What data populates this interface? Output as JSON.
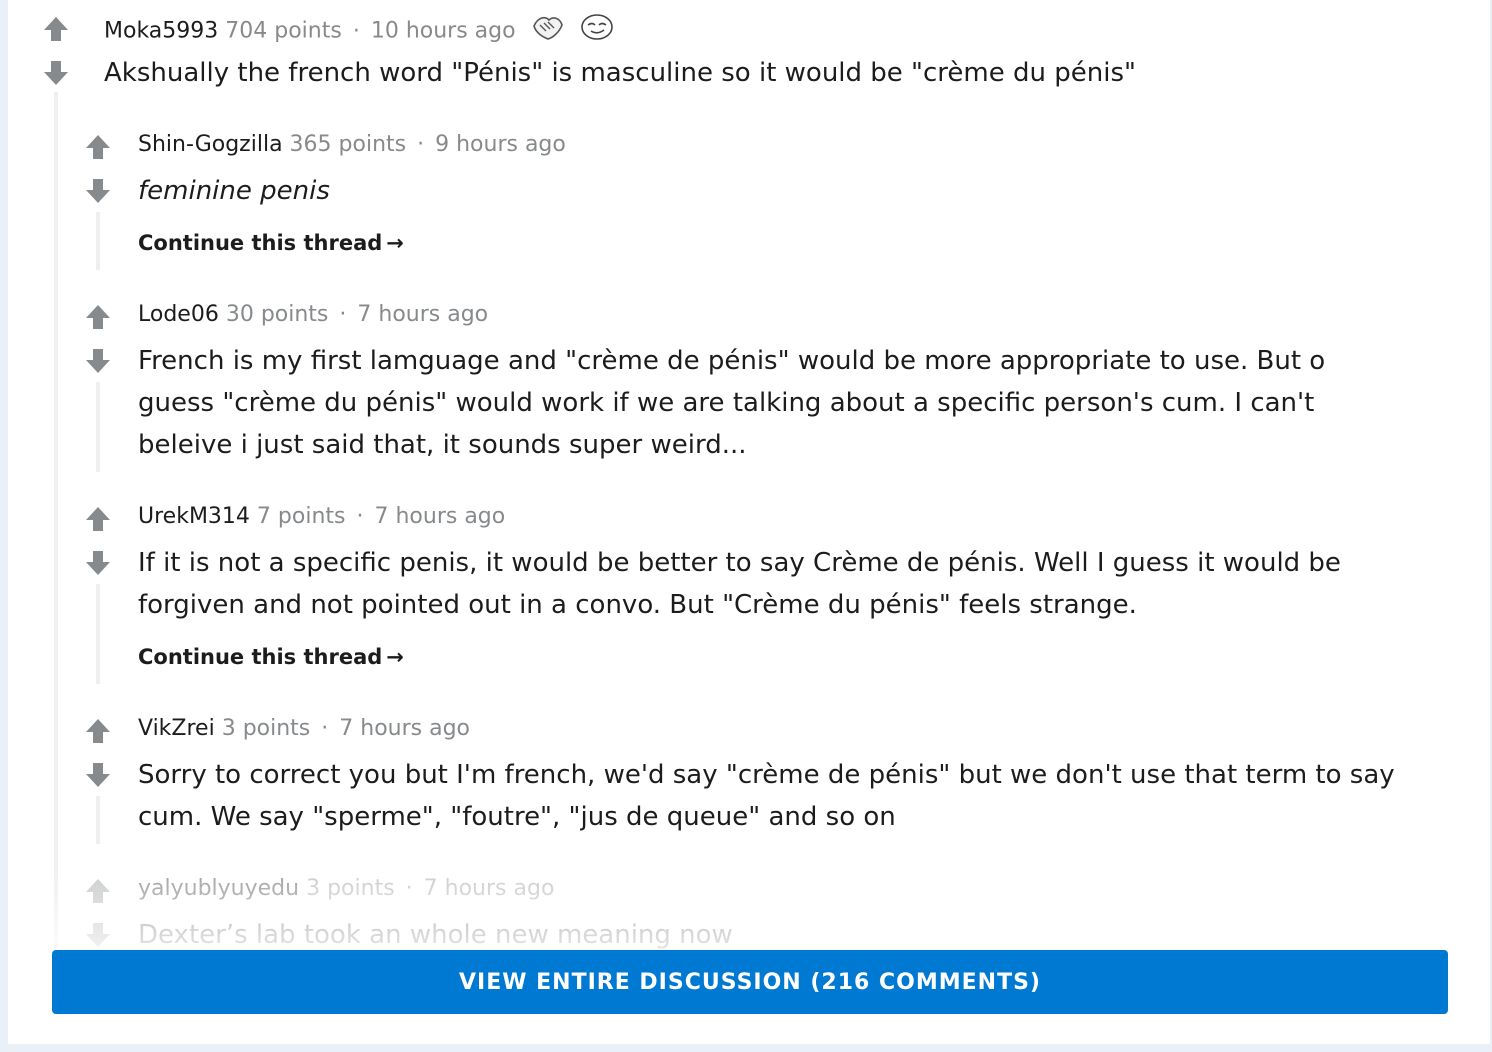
{
  "comments": [
    {
      "author": "Moka5993",
      "points": "704 points",
      "time": "10 hours ago",
      "body": "Akshually the french word \"Pénis\" is masculine so it would be \"crème du pénis\""
    },
    {
      "author": "Shin-Gogzilla",
      "points": "365 points",
      "time": "9 hours ago",
      "body": "feminine penis",
      "continue_label": "Continue this thread"
    },
    {
      "author": "Lode06",
      "points": "30 points",
      "time": "7 hours ago",
      "body": "French is my first lamguage and \"crème de pénis\" would be more appropriate to use. But o\nguess \"crème du pénis\" would work if we are talking about a specific person's cum. I can't\nbeleive i just said that, it sounds super weird..."
    },
    {
      "author": "UrekM314",
      "points": "7 points",
      "time": "7 hours ago",
      "body": "If it is not a specific penis, it would be better to say Crème de pénis. Well I guess it would be\nforgiven and not pointed out in a convo. But \"Crème du pénis\" feels strange.",
      "continue_label": "Continue this thread"
    },
    {
      "author": "VikZrei",
      "points": "3 points",
      "time": "7 hours ago",
      "body": "Sorry to correct you but I'm french, we'd say \"crème de pénis\" but we don't use that term to say\ncum. We say \"sperme\", \"foutre\", \"jus de queue\" and so on"
    },
    {
      "author": "yalyublyuyedu",
      "points": "3 points",
      "time": "7 hours ago",
      "body": "Dexter’s lab took an whole new meaning now"
    }
  ],
  "meta_separator": "·",
  "continue_arrow": "→",
  "view_button_label": "VIEW ENTIRE DISCUSSION (216 COMMENTS)",
  "colors": {
    "accent": "#0079d3",
    "vote_arrow": "#878a8c",
    "text": "#1c1c1c",
    "meta": "#878a8c",
    "background": "#eaf0f7"
  },
  "icons": {
    "upvote": "upvote-arrow-icon",
    "downvote": "downvote-arrow-icon",
    "awards": [
      "award-handshake-icon",
      "award-face-icon"
    ]
  }
}
